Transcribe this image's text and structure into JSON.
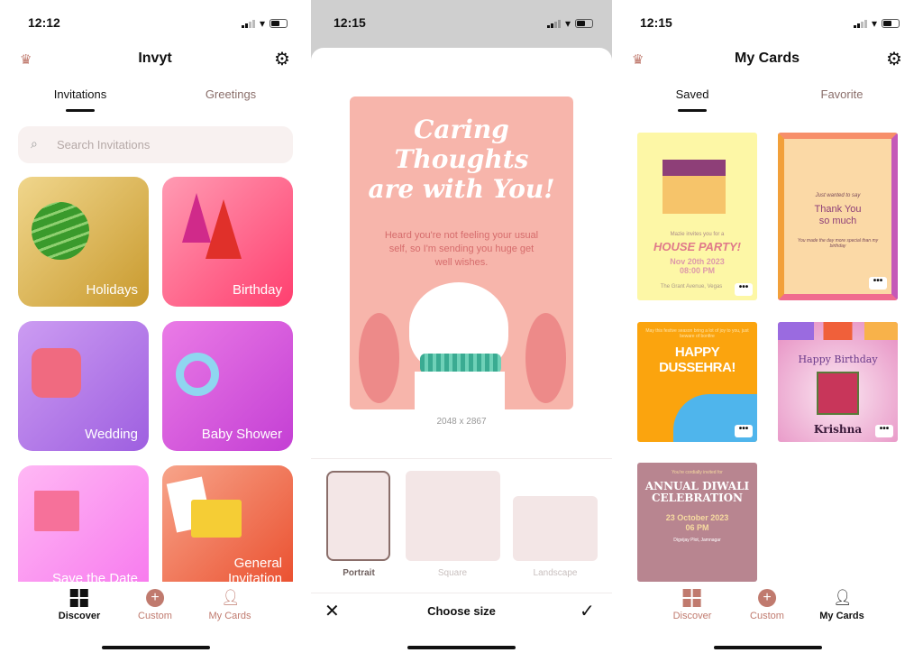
{
  "discover": {
    "status_time": "12:12",
    "title": "Invyt",
    "tabs": [
      {
        "label": "Invitations",
        "active": true
      },
      {
        "label": "Greetings",
        "active": false
      }
    ],
    "search_placeholder": "Search Invitations",
    "categories": [
      {
        "label": "Holidays",
        "color": "#d9b24f"
      },
      {
        "label": "Birthday",
        "color": "#ff5f88"
      },
      {
        "label": "Wedding",
        "color": "#b77be6"
      },
      {
        "label": "Baby Shower",
        "color": "#d552d9"
      },
      {
        "label": "Save the Date",
        "color": "#f98ef0"
      },
      {
        "label": "General Invitation",
        "color": "#ef6a4c"
      }
    ]
  },
  "choose_size": {
    "status_time": "12:15",
    "card": {
      "title": "Caring Thoughts are with You!",
      "message": "Heard you're not feeling your usual self, so I'm sending you huge get well wishes.",
      "color": "#f7b5ab"
    },
    "dimensions": "2048 x 2867",
    "options": [
      {
        "label": "Portrait",
        "selected": true
      },
      {
        "label": "Square",
        "selected": false
      },
      {
        "label": "Landscape",
        "selected": false
      }
    ],
    "title": "Choose size",
    "close_icon": "close-icon",
    "confirm_icon": "check-icon"
  },
  "my_cards": {
    "status_time": "12:15",
    "title": "My Cards",
    "tabs": [
      {
        "label": "Saved",
        "active": true
      },
      {
        "label": "Favorite",
        "active": false
      }
    ],
    "cards": [
      {
        "lines": [
          "Mazie invites you for a",
          "HOUSE PARTY!",
          "Nov 20th 2023",
          "08:00 PM",
          "The Grant Avenue, Vegas"
        ]
      },
      {
        "lines": [
          "Just wanted to say",
          "Thank You",
          "so much",
          "You made the day more special than my birthday"
        ]
      },
      {
        "lines": [
          "May this festive season bring a lot of joy to you, just beware of bonfire",
          "HAPPY DUSSEHRA!"
        ]
      },
      {
        "lines": [
          "Happy Birthday",
          "Krishna"
        ]
      },
      {
        "lines": [
          "You're cordially invited for",
          "ANNUAL DIWALI CELEBRATION",
          "23 October 2023",
          "06 PM",
          "Digvijay Plot, Jamnagar"
        ]
      }
    ],
    "more_label": "•••"
  },
  "nav": {
    "items": [
      "Discover",
      "Custom",
      "My Cards"
    ]
  },
  "colors": {
    "accent": "#c07a6e",
    "muted": "#8a6e6a"
  }
}
